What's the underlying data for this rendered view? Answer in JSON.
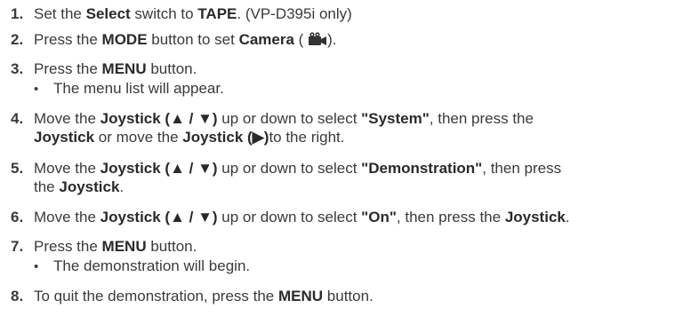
{
  "steps": [
    {
      "num": "1.",
      "a": "Set the ",
      "b1": "Select",
      "c": " switch to ",
      "b2": "TAPE",
      "d": ". (VP-D395i only)"
    },
    {
      "num": "2.",
      "a": "Press the ",
      "b1": "MODE",
      "c": " button to set ",
      "b2": "Camera",
      "d": " (",
      "icon": "camera-mode-icon",
      "e": ")."
    },
    {
      "num": "3.",
      "a": "Press the ",
      "b1": "MENU",
      "c": " button.",
      "sub": "The menu list will appear."
    },
    {
      "num": "4.",
      "a": "Move the ",
      "b1": "Joystick (▲ / ▼)",
      "c": " up or down to select ",
      "b2": "\"System\"",
      "d": ", then press the",
      "l2_b1": "Joystick",
      "l2_c": " or move the ",
      "l2_b2": "Joystick (▶)",
      "l2_d": "to the right."
    },
    {
      "num": "5.",
      "a": "Move the ",
      "b1": "Joystick (▲ / ▼)",
      "c": " up or down to select ",
      "b2": "\"Demonstration\"",
      "d": ", then press",
      "l2_a": "the ",
      "l2_b1": "Joystick",
      "l2_c": "."
    },
    {
      "num": "6.",
      "a": "Move the ",
      "b1": "Joystick (▲ / ▼)",
      "c": " up or down to select ",
      "b2": "\"On\"",
      "d": ", then press the ",
      "b3": "Joystick",
      "e": "."
    },
    {
      "num": "7.",
      "a": "Press the ",
      "b1": "MENU",
      "c": " button.",
      "sub": "The demonstration will begin."
    },
    {
      "num": "8.",
      "a": "To quit the demonstration, press the ",
      "b1": "MENU",
      "c": " button."
    }
  ],
  "bullet": "•"
}
